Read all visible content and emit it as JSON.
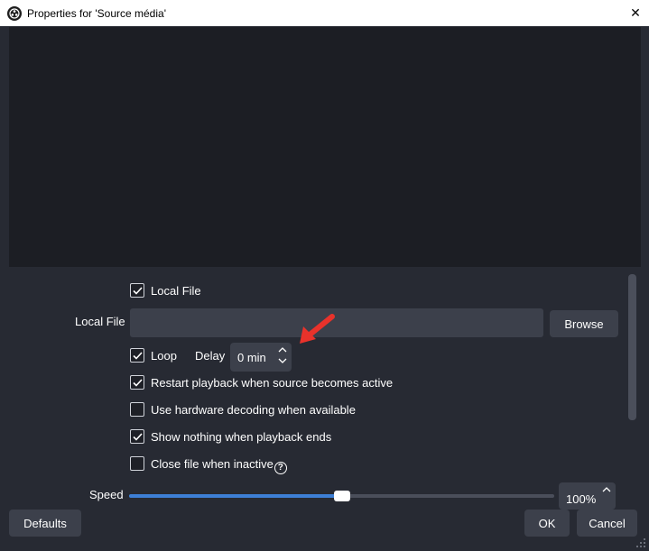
{
  "window": {
    "title": "Properties for 'Source média'",
    "close_glyph": "✕"
  },
  "form": {
    "local_file_checkbox": {
      "label": "Local File",
      "checked": true
    },
    "local_file_field": {
      "label": "Local File",
      "value": ""
    },
    "browse_label": "Browse",
    "loop": {
      "label": "Loop",
      "checked": true
    },
    "delay": {
      "label": "Delay",
      "value": "0 min"
    },
    "options": [
      {
        "label": "Restart playback when source becomes active",
        "checked": true
      },
      {
        "label": "Use hardware decoding when available",
        "checked": false
      },
      {
        "label": "Show nothing when playback ends",
        "checked": true
      },
      {
        "label": "Close file when inactive",
        "checked": false
      }
    ],
    "help_glyph": "?",
    "speed": {
      "label": "Speed",
      "value": "100%",
      "fraction": 0.5
    }
  },
  "footer": {
    "defaults_label": "Defaults",
    "ok_label": "OK",
    "cancel_label": "Cancel"
  },
  "colors": {
    "background": "#272a33",
    "input": "#3c404b",
    "accent": "#3d7fd6",
    "annotation_arrow": "#e8322b"
  },
  "icons": {
    "app": "obs-logo-icon",
    "annotation": "red-arrow-icon"
  }
}
